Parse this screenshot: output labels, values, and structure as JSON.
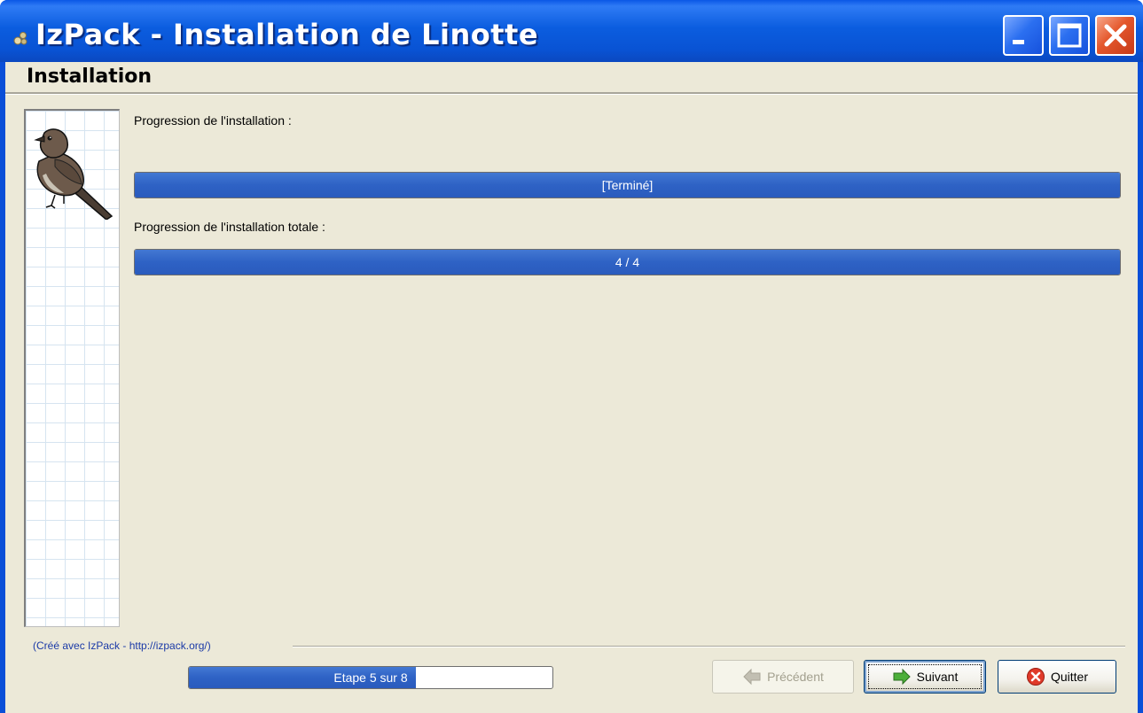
{
  "window": {
    "title": "IzPack - Installation de Linotte"
  },
  "panel": {
    "heading": "Installation"
  },
  "progress": {
    "current_label": "Progression de l'installation :",
    "current_text": "[Terminé]",
    "current_fraction": 1.0,
    "total_label": "Progression de l'installation totale :",
    "total_text": "4 / 4",
    "total_fraction": 1.0
  },
  "footer": {
    "credit": "(Créé avec IzPack - http://izpack.org/)",
    "step_text": "Etape 5 sur 8",
    "step_fraction": 0.625
  },
  "buttons": {
    "previous": "Précédent",
    "next": "Suivant",
    "quit": "Quitter"
  },
  "colors": {
    "accent": "#2e62c5",
    "background": "#ece9d8",
    "titlebar": "#0a57e6"
  },
  "icons": {
    "app": "izpack-icon",
    "side": "bird-icon",
    "previous": "left-arrow-icon",
    "next": "right-arrow-icon",
    "quit": "close-circle-icon"
  }
}
